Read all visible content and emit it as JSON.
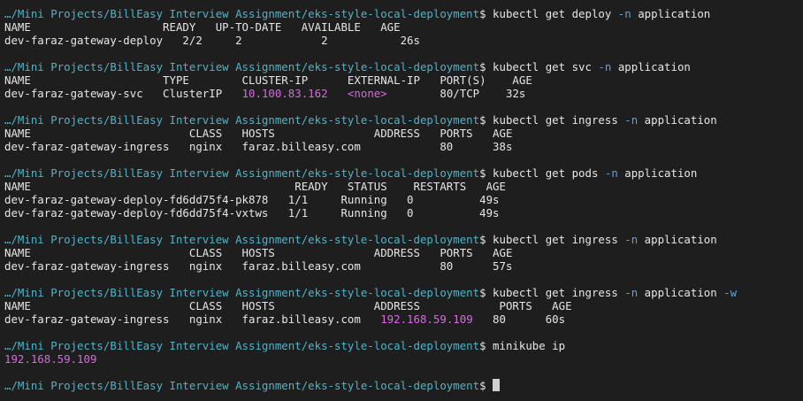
{
  "prompt_path": "…/Mini Projects/BillEasy Interview Assignment/eks-style-local-deployment",
  "prompt_symbol": "$",
  "blocks": [
    {
      "command": {
        "base": "kubectl get deploy",
        "flag": "-n",
        "arg": "application",
        "extra_flag": ""
      },
      "header": "NAME                    READY   UP-TO-DATE   AVAILABLE   AGE",
      "rows": [
        {
          "pre": "dev-faraz-gateway-deploy   2/2     2            2           26s",
          "ip": "",
          "mid": "",
          "tag": "",
          "post": ""
        }
      ]
    },
    {
      "command": {
        "base": "kubectl get svc",
        "flag": "-n",
        "arg": "application",
        "extra_flag": ""
      },
      "header": "NAME                    TYPE        CLUSTER-IP      EXTERNAL-IP   PORT(S)    AGE",
      "rows": [
        {
          "pre": "dev-faraz-gateway-svc   ClusterIP   ",
          "ip": "10.100.83.162",
          "mid": "   ",
          "tag": "<none>",
          "post": "        80/TCP    32s"
        }
      ]
    },
    {
      "command": {
        "base": "kubectl get ingress",
        "flag": "-n",
        "arg": "application",
        "extra_flag": ""
      },
      "header": "NAME                        CLASS   HOSTS               ADDRESS   PORTS   AGE",
      "rows": [
        {
          "pre": "dev-faraz-gateway-ingress   nginx   faraz.billeasy.com            80      38s",
          "ip": "",
          "mid": "",
          "tag": "",
          "post": ""
        }
      ]
    },
    {
      "command": {
        "base": "kubectl get pods",
        "flag": "-n",
        "arg": "application",
        "extra_flag": ""
      },
      "header": "NAME                                        READY   STATUS    RESTARTS   AGE",
      "rows": [
        {
          "pre": "dev-faraz-gateway-deploy-fd6dd75f4-pk878   1/1     Running   0          49s",
          "ip": "",
          "mid": "",
          "tag": "",
          "post": ""
        },
        {
          "pre": "dev-faraz-gateway-deploy-fd6dd75f4-vxtws   1/1     Running   0          49s",
          "ip": "",
          "mid": "",
          "tag": "",
          "post": ""
        }
      ]
    },
    {
      "command": {
        "base": "kubectl get ingress",
        "flag": "-n",
        "arg": "application",
        "extra_flag": ""
      },
      "header": "NAME                        CLASS   HOSTS               ADDRESS   PORTS   AGE",
      "rows": [
        {
          "pre": "dev-faraz-gateway-ingress   nginx   faraz.billeasy.com            80      57s",
          "ip": "",
          "mid": "",
          "tag": "",
          "post": ""
        }
      ]
    },
    {
      "command": {
        "base": "kubectl get ingress",
        "flag": "-n",
        "arg": "application",
        "extra_flag": "-w"
      },
      "header": "NAME                        CLASS   HOSTS               ADDRESS            PORTS   AGE",
      "rows": [
        {
          "pre": "dev-faraz-gateway-ingress   nginx   faraz.billeasy.com   ",
          "ip": "192.168.59.109",
          "mid": "",
          "tag": "",
          "post": "   80      60s"
        }
      ]
    },
    {
      "command": {
        "base": "minikube ip",
        "flag": "",
        "arg": "",
        "extra_flag": ""
      },
      "header": "",
      "rows": [
        {
          "pre": "",
          "ip": "192.168.59.109",
          "mid": "",
          "tag": "",
          "post": ""
        }
      ]
    }
  ],
  "colors": {
    "background": "#1e1e1e",
    "text": "#e6e6e6",
    "prompt_path": "#4fb3c9",
    "flag": "#5aa3e3",
    "highlight": "#d56bdf",
    "cursor": "#d0d0d0"
  }
}
